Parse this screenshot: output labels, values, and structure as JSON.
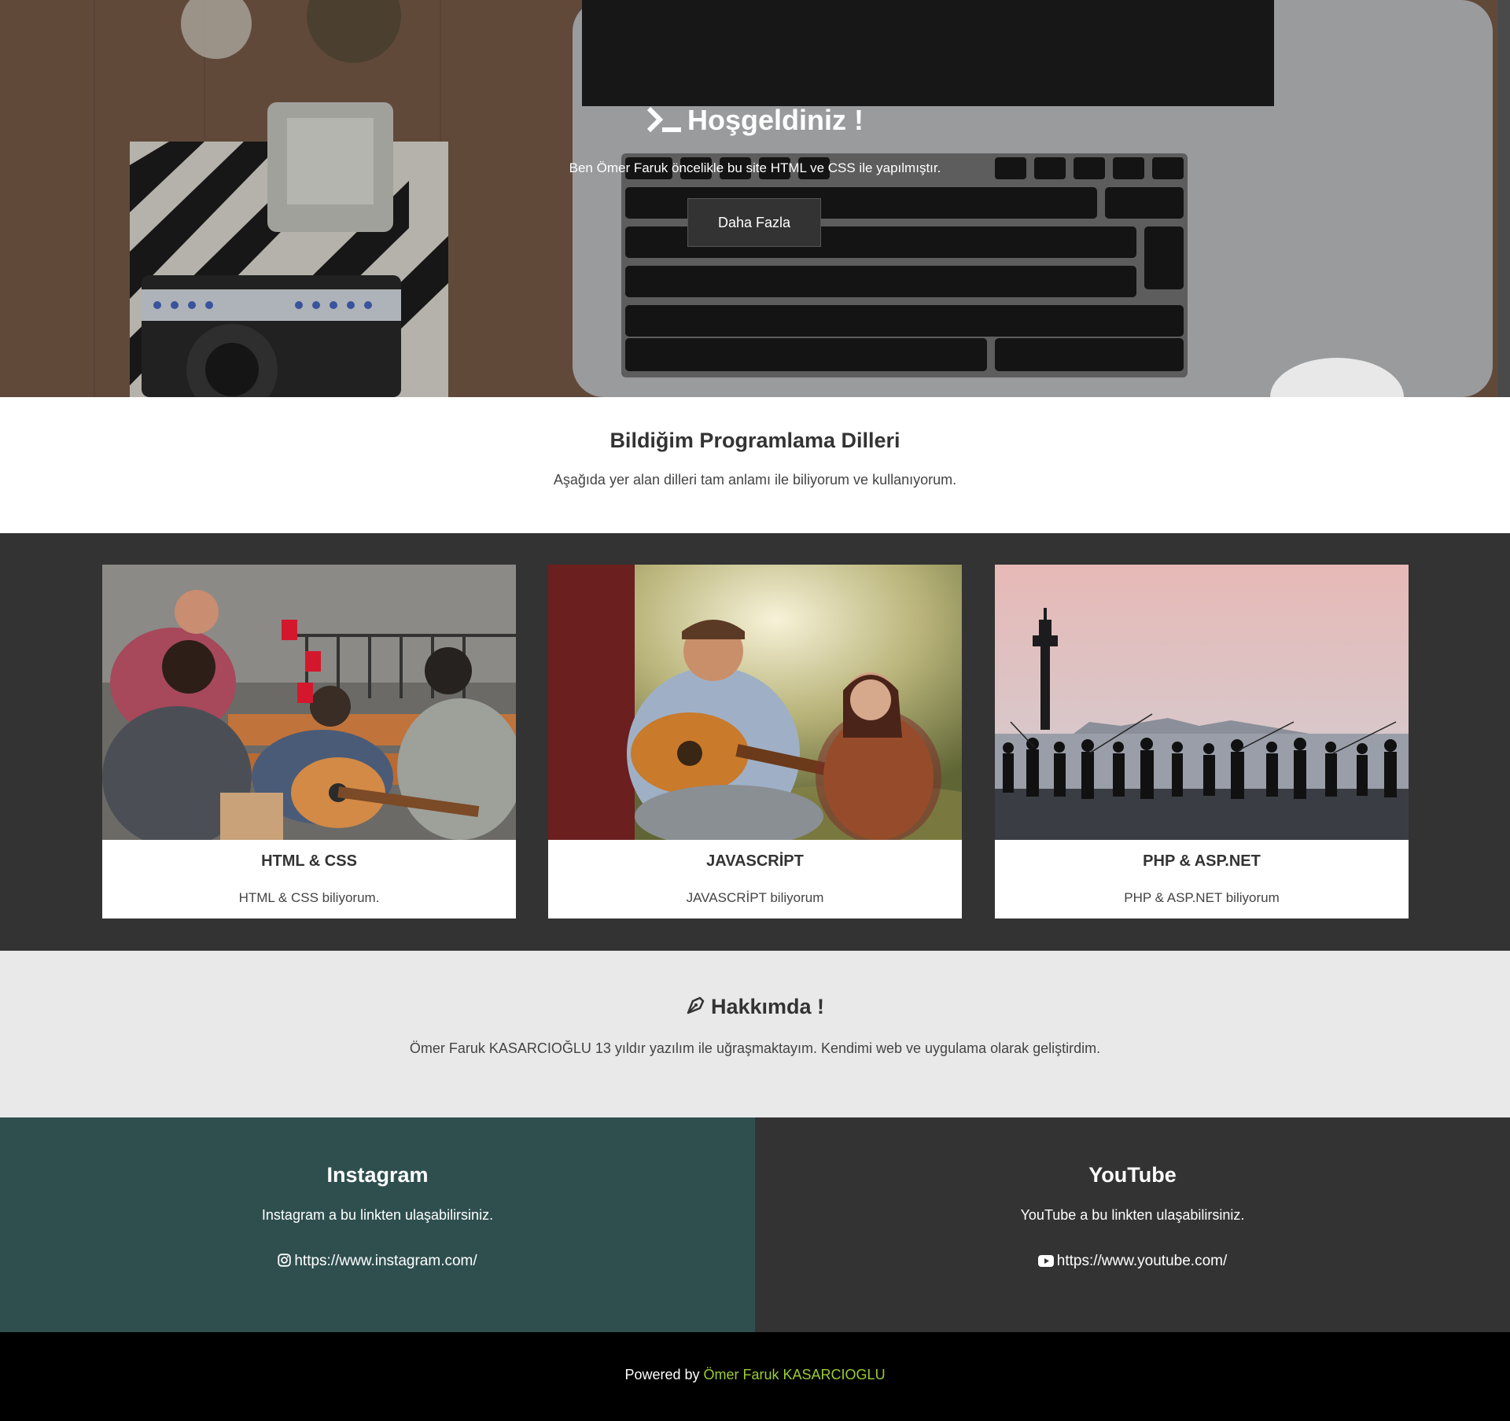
{
  "hero": {
    "title": "Hoşgeldiniz !",
    "subtitle": "Ben Ömer Faruk öncelikle bu site HTML ve CSS ile yapılmıştır.",
    "button_label": "Daha Fazla"
  },
  "languages": {
    "title": "Bildiğim Programlama Dilleri",
    "description": "Aşağıda yer alan dilleri tam anlamı ile biliyorum ve kullanıyorum."
  },
  "cards": [
    {
      "title": "HTML & CSS",
      "description": "HTML & CSS biliyorum."
    },
    {
      "title": "JAVASCRİPT",
      "description": "JAVASCRİPT biliyorum"
    },
    {
      "title": "PHP & ASP.NET",
      "description": "PHP & ASP.NET biliyorum"
    }
  ],
  "about": {
    "title": "Hakkımda !",
    "description": "Ömer Faruk KASARCIOĞLU 13 yıldır yazılım ile uğraşmaktayım. Kendimi web ve uygulama olarak geliştirdim."
  },
  "social": {
    "instagram": {
      "title": "Instagram",
      "description": "Instagram a bu linkten ulaşabilirsiniz.",
      "link": "https://www.instagram.com/",
      "icon": "instagram-icon",
      "bg_color": "#2f4f4f"
    },
    "youtube": {
      "title": "YouTube",
      "description": "YouTube a bu linkten ulaşabilirsiniz.",
      "link": "https://www.youtube.com/",
      "icon": "youtube-icon",
      "bg_color": "#333333"
    }
  },
  "footer": {
    "prefix": "Powered by",
    "author": "Ömer Faruk KASARCIOGLU",
    "author_color": "#9acd32"
  },
  "colors": {
    "dark": "#333333",
    "light_gray": "#e9e9e9",
    "footer_bg": "#000000"
  }
}
